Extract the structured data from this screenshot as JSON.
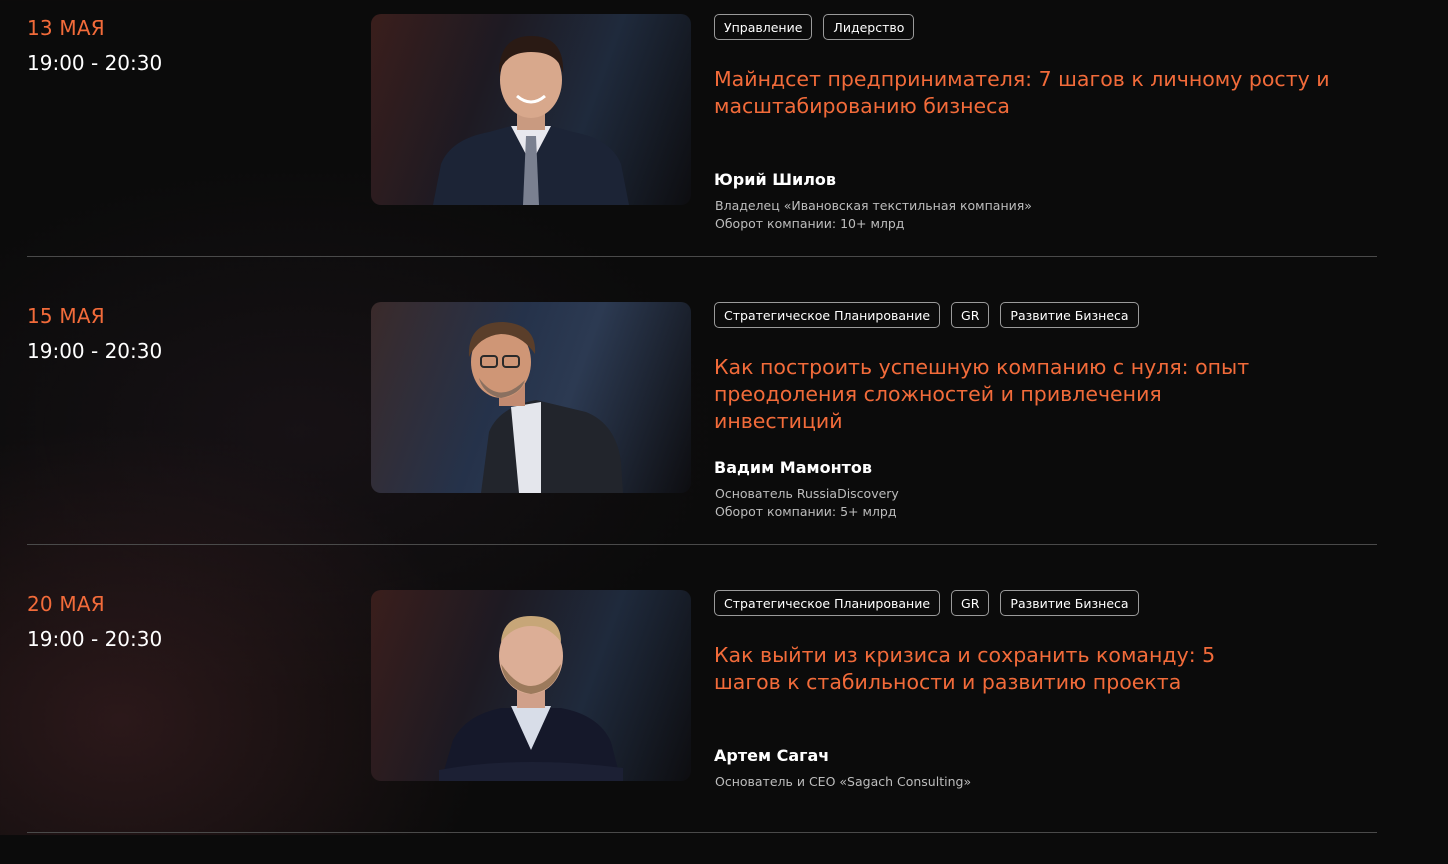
{
  "events": [
    {
      "date": "13 МАЯ",
      "time": "19:00 - 20:30",
      "tags": [
        "Управление",
        "Лидерство"
      ],
      "title": "Майндсет предпринимателя: 7 шагов к личному росту и масштабированию бизнеса",
      "speaker": "Юрий Шилов",
      "position": "Владелец «Ивановская текстильная компания»",
      "revenue": "Оборот компании: 10+ млрд"
    },
    {
      "date": "15 МАЯ",
      "time": "19:00 - 20:30",
      "tags": [
        "Стратегическое Планирование",
        "GR",
        "Развитие Бизнеса"
      ],
      "title": "Как построить успешную компанию с нуля: опыт преодоления сложностей и привлечения инвестиций",
      "speaker": "Вадим Мамонтов",
      "position": "Основатель RussiaDiscovery",
      "revenue": "Оборот компании: 5+ млрд"
    },
    {
      "date": "20 МАЯ",
      "time": "19:00 - 20:30",
      "tags": [
        "Стратегическое Планирование",
        "GR",
        "Развитие Бизнеса"
      ],
      "title": "Как выйти из кризиса и сохранить команду: 5 шагов к стабильности и развитию проекта",
      "speaker": "Артем Сагач",
      "position": "Основатель и CEO «Sagach Consulting»"
    }
  ],
  "colors": {
    "accent": "#f26b3a",
    "background": "#0b0b0b",
    "divider": "#4a4a4a",
    "tag_border": "#9a9a9a"
  }
}
